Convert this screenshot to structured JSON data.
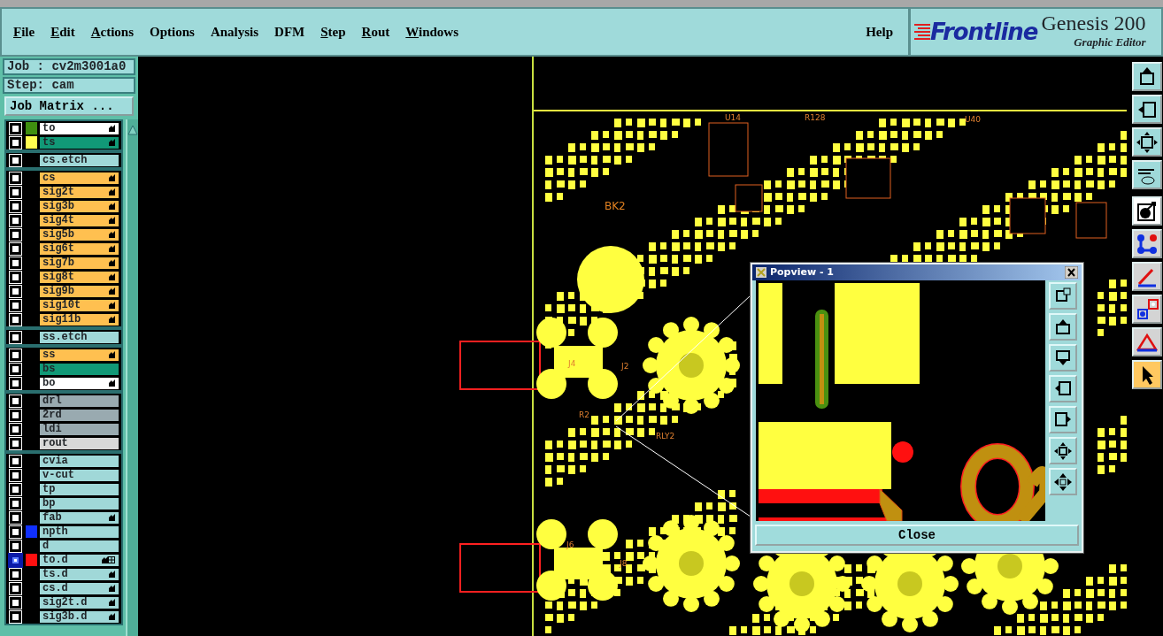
{
  "menu_bar": {
    "items": [
      {
        "label": "File",
        "mnemonic": true
      },
      {
        "label": "Edit",
        "mnemonic": true
      },
      {
        "label": "Actions",
        "mnemonic": true
      },
      {
        "label": "Options",
        "mnemonic": false
      },
      {
        "label": "Analysis",
        "mnemonic": false
      },
      {
        "label": "DFM",
        "mnemonic": false
      },
      {
        "label": "Step",
        "mnemonic": true
      },
      {
        "label": "Rout",
        "mnemonic": true
      },
      {
        "label": "Windows",
        "mnemonic": true
      }
    ],
    "help": "Help"
  },
  "logo": {
    "brand": "Frontline",
    "product": "Genesis 200",
    "subtitle": "Graphic Editor"
  },
  "job_panel": {
    "job": "Job : cv2m3001a0",
    "step": "Step: cam",
    "matrix_button": "Job Matrix ..."
  },
  "layer_groups": [
    {
      "layers": [
        {
          "name": "to",
          "kind": "silk",
          "color": "#3f8f10",
          "affected": true,
          "selected": false
        },
        {
          "name": "ts",
          "kind": "mask",
          "color": "#ffff50",
          "affected": true,
          "selected": false
        }
      ]
    },
    {
      "layers": [
        {
          "name": "cs.etch",
          "kind": "misc",
          "affected": false,
          "selected": false
        }
      ]
    },
    {
      "layers": [
        {
          "name": "cs",
          "kind": "signal",
          "affected": true,
          "selected": false
        },
        {
          "name": "sig2t",
          "kind": "signal",
          "affected": true,
          "selected": false
        },
        {
          "name": "sig3b",
          "kind": "signal",
          "affected": true,
          "selected": false
        },
        {
          "name": "sig4t",
          "kind": "signal",
          "affected": true,
          "selected": false
        },
        {
          "name": "sig5b",
          "kind": "signal",
          "affected": true,
          "selected": false
        },
        {
          "name": "sig6t",
          "kind": "signal",
          "affected": true,
          "selected": false
        },
        {
          "name": "sig7b",
          "kind": "signal",
          "affected": true,
          "selected": false
        },
        {
          "name": "sig8t",
          "kind": "signal",
          "affected": true,
          "selected": false
        },
        {
          "name": "sig9b",
          "kind": "signal",
          "affected": true,
          "selected": false
        },
        {
          "name": "sig10t",
          "kind": "signal",
          "affected": true,
          "selected": false
        },
        {
          "name": "sig11b",
          "kind": "signal",
          "affected": true,
          "selected": false
        }
      ]
    },
    {
      "layers": [
        {
          "name": "ss.etch",
          "kind": "misc",
          "affected": false,
          "selected": false
        }
      ]
    },
    {
      "layers": [
        {
          "name": "ss",
          "kind": "signal",
          "affected": true,
          "selected": false
        },
        {
          "name": "bs",
          "kind": "mask",
          "affected": false,
          "selected": false
        },
        {
          "name": "bo",
          "kind": "silk",
          "affected": true,
          "selected": false
        }
      ]
    },
    {
      "layers": [
        {
          "name": "drl",
          "kind": "drill",
          "affected": false,
          "selected": false
        },
        {
          "name": "2rd",
          "kind": "drill",
          "affected": false,
          "selected": false
        },
        {
          "name": "ldi",
          "kind": "drill",
          "affected": false,
          "selected": false
        },
        {
          "name": "rout",
          "kind": "rout",
          "affected": false,
          "selected": false
        }
      ]
    },
    {
      "layers": [
        {
          "name": "cvia",
          "kind": "misc",
          "affected": false,
          "selected": false
        },
        {
          "name": "v-cut",
          "kind": "misc",
          "affected": false,
          "selected": false
        },
        {
          "name": "tp",
          "kind": "misc",
          "affected": false,
          "selected": false
        },
        {
          "name": "bp",
          "kind": "misc",
          "affected": false,
          "selected": false
        },
        {
          "name": "fab",
          "kind": "misc",
          "affected": true,
          "selected": false
        },
        {
          "name": "npth",
          "kind": "misc",
          "color": "#1030ff",
          "affected": false,
          "selected": false
        },
        {
          "name": "d",
          "kind": "misc",
          "affected": false,
          "selected": false
        },
        {
          "name": "to.d",
          "kind": "misc",
          "color": "#ff1010",
          "affected": true,
          "selected": true
        },
        {
          "name": "ts.d",
          "kind": "misc",
          "affected": true,
          "selected": false
        },
        {
          "name": "cs.d",
          "kind": "misc",
          "affected": true,
          "selected": false
        },
        {
          "name": "sig2t.d",
          "kind": "misc",
          "affected": true,
          "selected": false
        },
        {
          "name": "sig3b.d",
          "kind": "misc",
          "affected": true,
          "selected": false
        }
      ]
    }
  ],
  "canvas": {
    "labels": [
      "BK2",
      "J4",
      "J2",
      "U14",
      "R128",
      "U40",
      "RLY2",
      "R2",
      "J6",
      "J8"
    ]
  },
  "popview": {
    "title": "Popview - 1",
    "close_button": "Close"
  },
  "toolbar": [
    {
      "kind": "view",
      "selected": false
    },
    {
      "kind": "view",
      "selected": false
    },
    {
      "kind": "view",
      "selected": false
    },
    {
      "kind": "view",
      "selected": false
    },
    {
      "kind": "mode",
      "selected": false
    },
    {
      "kind": "edit",
      "selected": false
    },
    {
      "kind": "edit",
      "selected": false
    },
    {
      "kind": "edit",
      "selected": false
    },
    {
      "kind": "edit",
      "selected": false
    },
    {
      "kind": "edit",
      "selected": true
    }
  ]
}
